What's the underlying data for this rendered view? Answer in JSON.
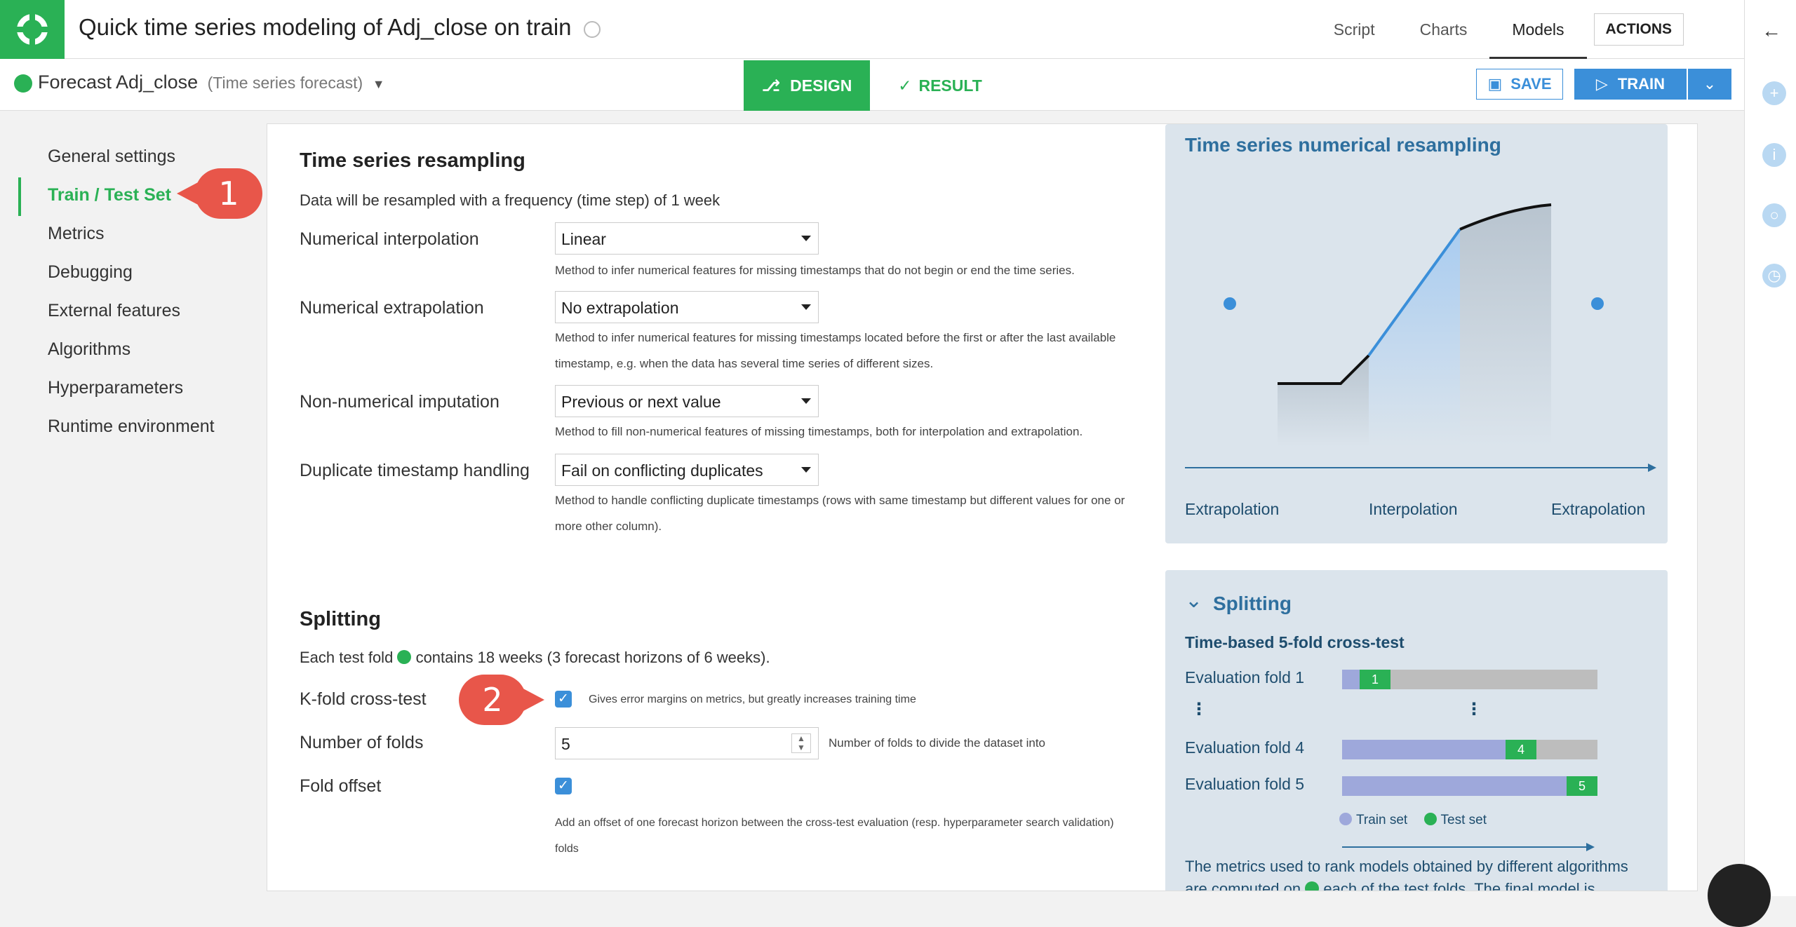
{
  "header": {
    "title": "Quick time series modeling of Adj_close on train",
    "nav": [
      "Script",
      "Charts",
      "Models"
    ],
    "active_nav": "Models",
    "actions_label": "ACTIONS"
  },
  "subbar": {
    "forecast_name": "Forecast Adj_close",
    "forecast_type": "(Time series forecast)",
    "design_label": "DESIGN",
    "result_label": "RESULT",
    "save_label": "SAVE",
    "train_label": "TRAIN"
  },
  "sidebar": {
    "items": [
      {
        "label": "General settings"
      },
      {
        "label": "Train / Test Set"
      },
      {
        "label": "Metrics"
      },
      {
        "label": "Debugging"
      },
      {
        "label": "External features"
      },
      {
        "label": "Algorithms"
      },
      {
        "label": "Hyperparameters"
      },
      {
        "label": "Runtime environment"
      }
    ],
    "active_index": 1
  },
  "callouts": [
    "1",
    "2"
  ],
  "resampling": {
    "title": "Time series resampling",
    "description": "Data will be resampled with a frequency (time step) of 1 week",
    "fields": [
      {
        "label": "Numerical interpolation",
        "value": "Linear",
        "help": "Method to infer numerical features for missing timestamps that do not begin or end the time series."
      },
      {
        "label": "Numerical extrapolation",
        "value": "No extrapolation",
        "help": "Method to infer numerical features for missing timestamps located before the first or after the last available timestamp, e.g. when the data has several time series of different sizes."
      },
      {
        "label": "Non-numerical imputation",
        "value": "Previous or next value",
        "help": "Method to fill non-numerical features of missing timestamps, both for interpolation and extrapolation."
      },
      {
        "label": "Duplicate timestamp handling",
        "value": "Fail on conflicting duplicates",
        "help": "Method to handle conflicting duplicate timestamps (rows with same timestamp but different values for one or more other column)."
      }
    ]
  },
  "splitting": {
    "title": "Splitting",
    "desc_pre": "Each test fold",
    "desc_post": "contains 18 weeks (3 forecast horizons of 6 weeks).",
    "kfold_label": "K-fold cross-test",
    "kfold_help": "Gives error margins on metrics, but greatly increases training time",
    "folds_label": "Number of folds",
    "folds_value": "5",
    "folds_help": "Number of folds to divide the dataset into",
    "offset_label": "Fold offset",
    "offset_help": "Add an offset of one forecast horizon between the cross-test evaluation (resp. hyperparameter search validation) folds"
  },
  "resampling_panel": {
    "title": "Time series numerical resampling",
    "labels": [
      "Extrapolation",
      "Interpolation",
      "Extrapolation"
    ]
  },
  "splitting_panel": {
    "title": "Splitting",
    "subtitle": "Time-based 5-fold cross-test",
    "folds": [
      {
        "label": "Evaluation fold 1",
        "test_label": "1",
        "train_frac": 0.07,
        "test_frac": 0.12
      },
      {
        "label": "Evaluation fold 4",
        "test_label": "4",
        "train_frac": 0.64,
        "test_frac": 0.12
      },
      {
        "label": "Evaluation fold 5",
        "test_label": "5",
        "train_frac": 0.88,
        "test_frac": 0.12
      }
    ],
    "legend_train": "Train set",
    "legend_test": "Test set",
    "footer_line1": "The metrics used to rank models obtained by different algorithms",
    "footer_line2_pre": "are computed on",
    "footer_line2_post": "each of the test folds. The final model is"
  },
  "colors": {
    "accent_green": "#2ab155",
    "accent_blue": "#3b8fd9",
    "callout_red": "#e8564a",
    "train_purple": "#9ea8db",
    "panel_bg": "#dbe4ec"
  }
}
